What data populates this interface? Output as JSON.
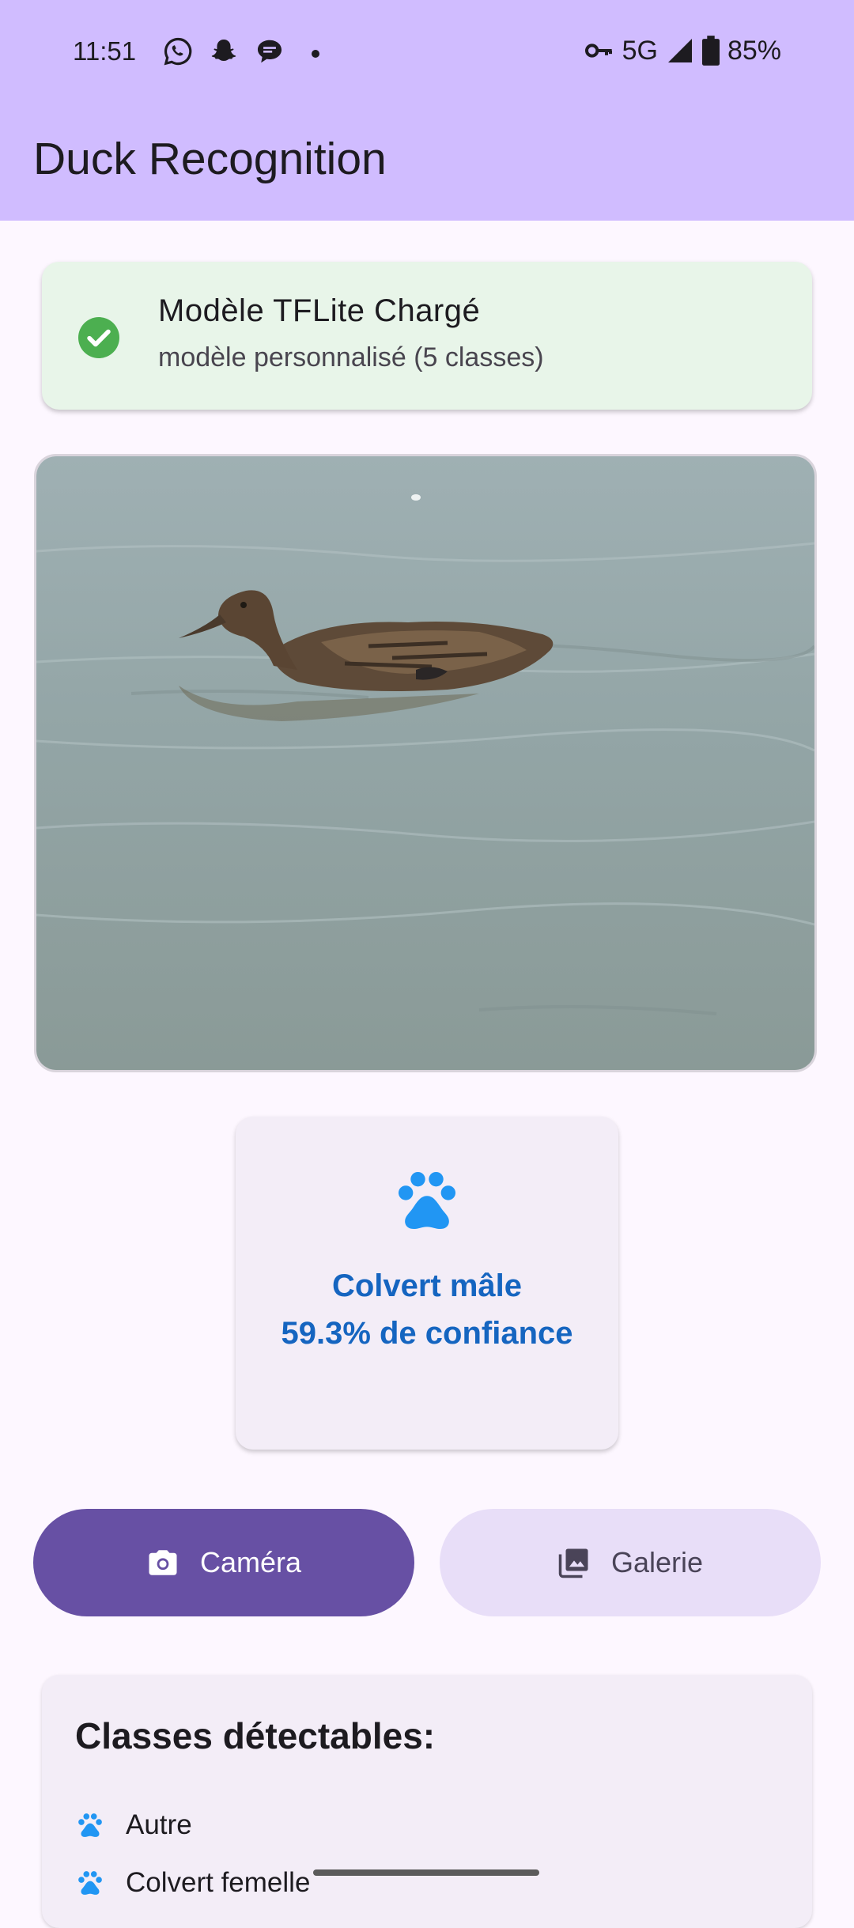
{
  "status_bar": {
    "time": "11:51",
    "network": "5G",
    "battery": "85%",
    "left_icons": [
      "whatsapp-icon",
      "snapchat-icon",
      "chat-bubble-icon"
    ],
    "right_icons": [
      "vpn-key-icon",
      "signal-icon",
      "battery-icon"
    ]
  },
  "app_bar": {
    "title": "Duck Recognition"
  },
  "model_status": {
    "title": "Modèle TFLite Chargé",
    "subtitle": "modèle personnalisé (5 classes)",
    "icon": "check-circle-icon",
    "color": "#4caf50"
  },
  "result": {
    "icon": "paw-icon",
    "label": "Colvert mâle",
    "confidence_text": "59.3% de confiance",
    "color": "#1565c0"
  },
  "buttons": {
    "camera_label": "Caméra",
    "gallery_label": "Galerie"
  },
  "classes": {
    "title": "Classes détectables:",
    "items": [
      "Autre",
      "Colvert femelle"
    ]
  },
  "colors": {
    "app_bar": "#d0bcff",
    "primary": "#6750a4",
    "secondary_container": "#e8def8",
    "accent_blue": "#2196f3"
  }
}
